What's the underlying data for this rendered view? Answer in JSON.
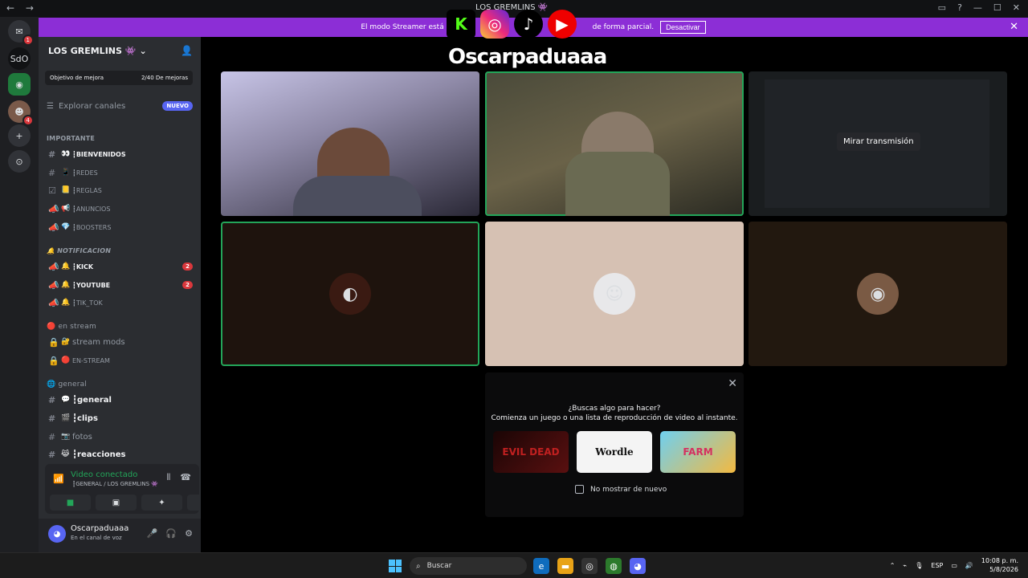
{
  "window": {
    "title": "LOS GREMLINS 👾",
    "back": "←",
    "forward": "→",
    "icons": [
      "inbox-icon",
      "help-icon",
      "minimize-icon",
      "maximize-icon",
      "close-icon"
    ]
  },
  "banner": {
    "text": "El modo Streamer está activado. Se ocultará información de forma parcial.",
    "visible_left": "El modo Streamer está act",
    "visible_right": "de forma parcial.",
    "button": "Desactivar"
  },
  "overlay": {
    "socials": [
      "K",
      "◎",
      "♪",
      "▶"
    ],
    "name": "Oscarpaduaaa"
  },
  "rail": {
    "items": [
      {
        "label": "✉",
        "badge": "1"
      },
      {
        "label": "SdO",
        "badge": ""
      },
      {
        "label": "◉",
        "badge": ""
      },
      {
        "label": "☻",
        "badge": "4"
      },
      {
        "label": "+",
        "badge": ""
      },
      {
        "label": "⊙",
        "badge": ""
      }
    ]
  },
  "server": {
    "name": "LOS GREMLINS 👾",
    "boost_label": "Objetivo de mejora",
    "boost_progress": "2/40 De mejoras",
    "explore": "Explorar canales",
    "new_badge": "NUEVO"
  },
  "categories": {
    "importante": "IMPORTANTE",
    "notificacion": "NOTIFICACION",
    "en_stream": "en stream",
    "general": "general"
  },
  "channels": {
    "bienvenidos": {
      "emoji": "👀",
      "name": "┇BIENVENIDOS"
    },
    "redes": {
      "emoji": "📱",
      "name": "┇REDES"
    },
    "reglas": {
      "emoji": "📒",
      "name": "┇REGLAS"
    },
    "anuncios": {
      "emoji": "📢",
      "name": "┇ANUNCIOS"
    },
    "boosters": {
      "emoji": "💎",
      "name": "┇BOOSTERS"
    },
    "kick": {
      "emoji": "🔔",
      "name": "┇KICK",
      "count": "2"
    },
    "youtube": {
      "emoji": "🔔",
      "name": "┇YOUTUBE",
      "count": "2"
    },
    "tiktok": {
      "emoji": "🔔",
      "name": "┇TIK_TOK"
    },
    "stream_mods": {
      "emoji": "🔐",
      "name": "stream mods"
    },
    "en_stream": {
      "emoji": "🔴",
      "name": "EN-STREAM"
    },
    "general": {
      "emoji": "💬",
      "name": "┇general"
    },
    "clips": {
      "emoji": "🎬",
      "name": "┇clips"
    },
    "fotos": {
      "emoji": "📷",
      "name": "fotos"
    },
    "reacciones": {
      "emoji": "😹",
      "name": "┇reacciones"
    }
  },
  "voice": {
    "status": "Video conectado",
    "location": "┇GENERAL / LOS GREMLINS 👾"
  },
  "user": {
    "name": "Oscarpaduaaa",
    "status": "En el canal de voz"
  },
  "stage": {
    "watch_stream": "Mirar transmisión"
  },
  "activity": {
    "line1": "¿Buscas algo para hacer?",
    "line2": "Comienza un juego o una lista de reproducción de video al instante.",
    "games": [
      "EVIL DEAD",
      "Wordle",
      "FARM"
    ],
    "dont_show": "No mostrar de nuevo"
  },
  "taskbar": {
    "search": "Buscar",
    "lang": "ESP",
    "time": "10:08 p. m.",
    "date": "5/8/2026"
  },
  "colors": {
    "accent": "#5865f2",
    "banner": "#8c2ed6",
    "speaking": "#23a559",
    "danger": "#da373c"
  }
}
